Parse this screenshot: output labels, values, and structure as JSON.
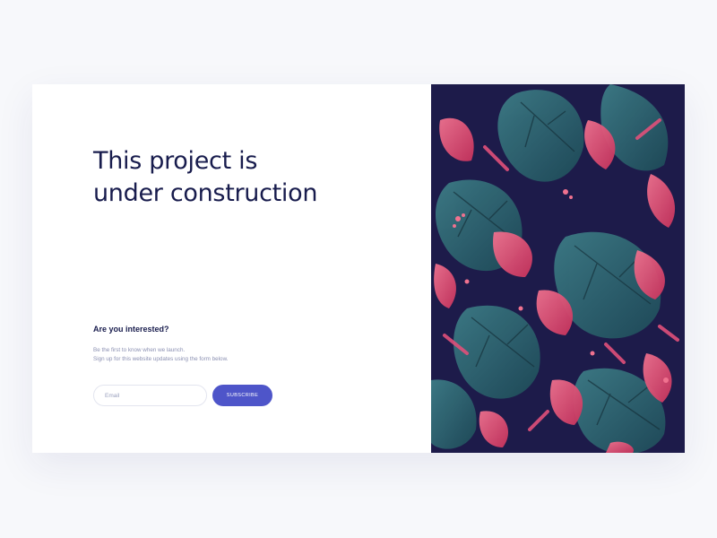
{
  "hero": {
    "headline_lines": [
      "This project is",
      "under construction"
    ]
  },
  "signup": {
    "title": "Are you interested?",
    "description_lines": [
      "Be the first to know when we launch.",
      "Sign up for this website updates using the form below."
    ],
    "email_placeholder": "Email",
    "email_value": "",
    "subscribe_label": "SUBSCRIBE"
  },
  "colors": {
    "page_background": "#f7f8fb",
    "card_background": "#ffffff",
    "heading": "#181c4d",
    "muted_text": "#8b90b2",
    "accent": "#4e55c9",
    "art_background": "#1d1b4a",
    "leaf_teal": "#2c5f6a",
    "leaf_pink": "#e04a72"
  },
  "art": {
    "description_icon": "tropical-leaf-pattern"
  }
}
